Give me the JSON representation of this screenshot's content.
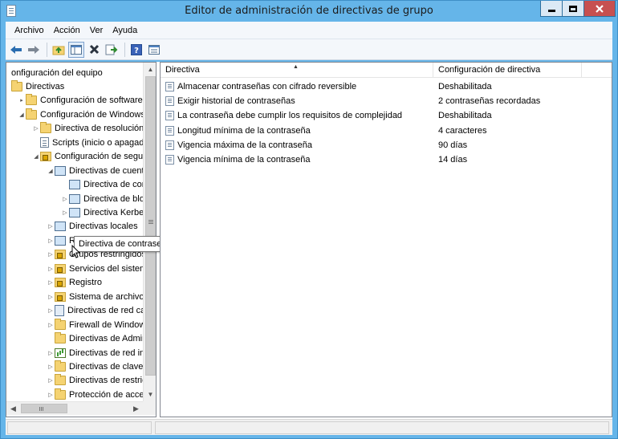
{
  "window": {
    "title": "Editor de administración de directivas de grupo"
  },
  "menubar": {
    "items": [
      "Archivo",
      "Acción",
      "Ver",
      "Ayuda"
    ]
  },
  "toolbar": {
    "icons": [
      "back-arrow-icon",
      "forward-arrow-icon",
      "up-folder-icon",
      "show-hide-tree-icon",
      "delete-icon",
      "export-list-icon",
      "help-icon",
      "properties-icon"
    ]
  },
  "tree": {
    "items": [
      {
        "label": "onfiguración del equipo",
        "icon": "computer-icon",
        "expand": "",
        "level": 0
      },
      {
        "label": "Directivas",
        "icon": "folder-icon",
        "expand": "",
        "level": 0
      },
      {
        "label": "Configuración de software",
        "icon": "folder-icon",
        "expand": "▸",
        "level": 1
      },
      {
        "label": "Configuración de Windows",
        "icon": "folder-icon",
        "expand": "◢",
        "level": 1
      },
      {
        "label": "Directiva de resolución",
        "icon": "folder-icon",
        "expand": "▷",
        "level": 2
      },
      {
        "label": "Scripts (inicio o apagad",
        "icon": "document-icon",
        "expand": "",
        "level": 2
      },
      {
        "label": "Configuración de segur",
        "icon": "lock-folder-icon",
        "expand": "◢",
        "level": 2
      },
      {
        "label": "Directivas de cuenta",
        "icon": "book-icon",
        "expand": "◢",
        "level": 3
      },
      {
        "label": "Directiva de contraseñas",
        "icon": "book-icon",
        "expand": "",
        "level": 4
      },
      {
        "label": "Directiva de bloq",
        "icon": "book-icon",
        "expand": "▷",
        "level": 4
      },
      {
        "label": "Directiva Kerbero",
        "icon": "book-icon",
        "expand": "▷",
        "level": 4
      },
      {
        "label": "Directivas locales",
        "icon": "book-icon",
        "expand": "▷",
        "level": 3
      },
      {
        "label": "Registro de eventos",
        "icon": "book-icon",
        "expand": "▷",
        "level": 3
      },
      {
        "label": "Grupos restringidos",
        "icon": "lock-folder-icon",
        "expand": "▷",
        "level": 3
      },
      {
        "label": "Servicios del sistema",
        "icon": "lock-folder-icon",
        "expand": "▷",
        "level": 3
      },
      {
        "label": "Registro",
        "icon": "lock-folder-icon",
        "expand": "▷",
        "level": 3
      },
      {
        "label": "Sistema de archivos",
        "icon": "lock-folder-icon",
        "expand": "▷",
        "level": 3
      },
      {
        "label": "Directivas de red cab",
        "icon": "network-icon",
        "expand": "▷",
        "level": 3
      },
      {
        "label": "Firewall de Windows",
        "icon": "folder-icon",
        "expand": "▷",
        "level": 3
      },
      {
        "label": "Directivas de Admin",
        "icon": "folder-icon",
        "expand": "",
        "level": 3
      },
      {
        "label": "Directivas de red ina",
        "icon": "bars-icon",
        "expand": "▷",
        "level": 3
      },
      {
        "label": "Directivas de clave p",
        "icon": "folder-icon",
        "expand": "▷",
        "level": 3
      },
      {
        "label": "Directivas de restricc",
        "icon": "folder-icon",
        "expand": "▷",
        "level": 3
      },
      {
        "label": "Protección de acces",
        "icon": "folder-icon",
        "expand": "▷",
        "level": 3
      }
    ],
    "tooltip": "Directiva de contraseñas"
  },
  "list": {
    "columns": [
      "Directiva",
      "Configuración de directiva"
    ],
    "rows": [
      {
        "policy": "Almacenar contraseñas con cifrado reversible",
        "setting": "Deshabilitada"
      },
      {
        "policy": "Exigir historial de contraseñas",
        "setting": "2 contraseñas recordadas"
      },
      {
        "policy": "La contraseña debe cumplir los requisitos de complejidad",
        "setting": "Deshabilitada"
      },
      {
        "policy": "Longitud mínima de la contraseña",
        "setting": "4 caracteres"
      },
      {
        "policy": "Vigencia máxima de la contraseña",
        "setting": "90 días"
      },
      {
        "policy": "Vigencia mínima de la contraseña",
        "setting": "14 días"
      }
    ]
  },
  "colors": {
    "titlebar": "#65b5e9",
    "close_button": "#c75050",
    "folder": "#f5d372"
  }
}
